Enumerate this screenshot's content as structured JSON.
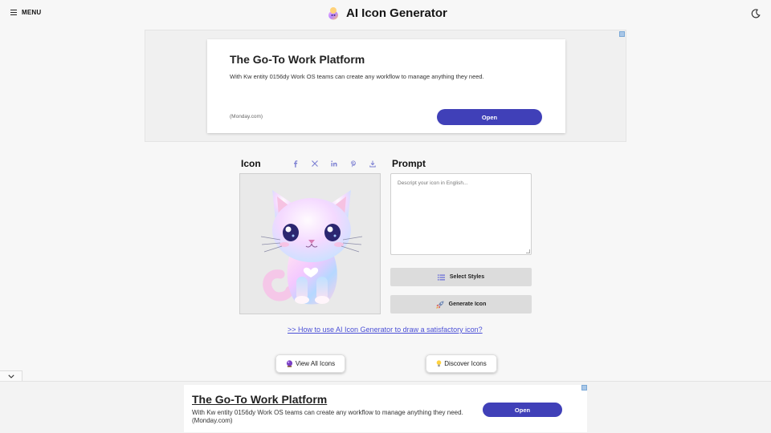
{
  "header": {
    "menu_label": "MENU",
    "title": "AI Icon Generator",
    "theme_icon": "moon-icon"
  },
  "ad_top": {
    "headline": "The Go-To Work Platform",
    "body": "With Kw entity 0156dy Work OS teams can create any workflow to manage anything they need.",
    "source": "(Monday.com)",
    "cta": "Open"
  },
  "icon_panel": {
    "heading": "Icon",
    "share_icons": [
      "facebook-icon",
      "x-icon",
      "linkedin-icon",
      "pinterest-icon",
      "download-icon"
    ],
    "image_subject": "cat"
  },
  "prompt_panel": {
    "heading": "Prompt",
    "placeholder": "Descript your icon in English...",
    "value": "",
    "select_styles_label": "Select Styles",
    "generate_label": "Generate Icon"
  },
  "howto_link": ">> How to use AI Icon Generator to draw a satisfactory icon?",
  "actions": {
    "view_all": "View All Icons",
    "discover": "Discover Icons"
  },
  "ad_bottom": {
    "headline": "The Go-To Work Platform",
    "body": "With Kw entity 0156dy Work OS teams can create any workflow to manage anything they need. (Monday.com)",
    "cta": "Open"
  },
  "colors": {
    "accent": "#4040b8",
    "link": "#4a4fd6",
    "share": "#7b7fd2"
  }
}
